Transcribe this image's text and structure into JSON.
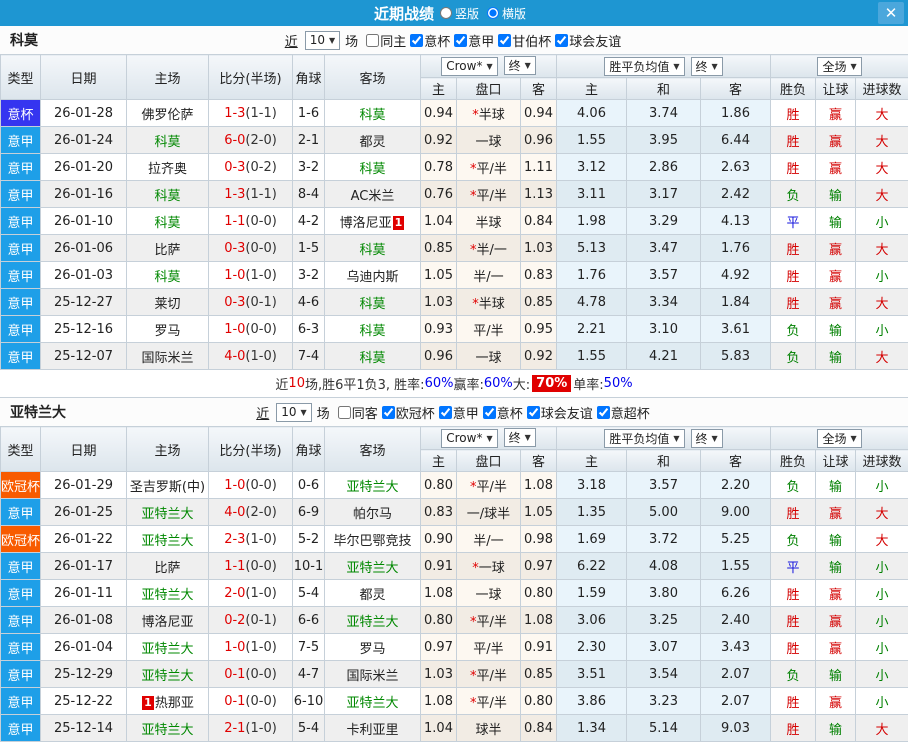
{
  "titlebar": {
    "title": "近期战绩",
    "vertical_label": "竖版",
    "horizontal_label": "横版",
    "close_glyph": "✕"
  },
  "table_header": {
    "main": [
      "类型",
      "日期",
      "主场",
      "比分(半场)",
      "角球",
      "客场"
    ],
    "bookmaker": "Crow*",
    "final": "终",
    "europe_avg": "胜平负均值",
    "scope": "全场",
    "sub": [
      "主",
      "盘口",
      "客",
      "主",
      "和",
      "客",
      "胜负",
      "让球",
      "进球数"
    ]
  },
  "result_color_map": {
    "胜": "r",
    "平": "b",
    "负": "g",
    "赢": "r",
    "输": "g",
    "大": "r",
    "小": "g"
  },
  "colors": {
    "titlebar": "#1E96D2",
    "serie_badge": "#1E9FE8",
    "cup_badge": "#3535F0",
    "ucl_badge": "#F85B00",
    "focus_team_green": "#008800",
    "score_red": "#E00000",
    "win_red": "#D40000",
    "draw_blue": "#1414DD",
    "lose_green": "#008000",
    "summary_pct_blue": "#0000EE"
  },
  "sections": [
    {
      "team": "科莫",
      "filter": {
        "near_label": "近",
        "count": "10",
        "games_label": "场",
        "same_label": "同主",
        "same_checked": false,
        "leagues": [
          "意杯",
          "意甲",
          "甘伯杯",
          "球会友谊"
        ]
      },
      "rows": [
        {
          "type": "意杯",
          "type_class": "cup",
          "date": "26-01-28",
          "home": "佛罗伦萨",
          "home_focus": false,
          "score": "1-3",
          "half": "(1-1)",
          "corner": "1-6",
          "away": "科莫",
          "away_focus": true,
          "ah": [
            "0.94",
            "*半球",
            "0.94"
          ],
          "eu": [
            "4.06",
            "3.74",
            "1.86"
          ],
          "res": [
            "胜",
            "赢",
            "大"
          ]
        },
        {
          "type": "意甲",
          "type_class": "serie",
          "date": "26-01-24",
          "home": "科莫",
          "home_focus": true,
          "score": "6-0",
          "half": "(2-0)",
          "corner": "2-1",
          "away": "都灵",
          "away_focus": false,
          "ah": [
            "0.92",
            "一球",
            "0.96"
          ],
          "eu": [
            "1.55",
            "3.95",
            "6.44"
          ],
          "res": [
            "胜",
            "赢",
            "大"
          ]
        },
        {
          "type": "意甲",
          "type_class": "serie",
          "date": "26-01-20",
          "home": "拉齐奥",
          "home_focus": false,
          "score": "0-3",
          "half": "(0-2)",
          "corner": "3-2",
          "away": "科莫",
          "away_focus": true,
          "ah": [
            "0.78",
            "*平/半",
            "1.11"
          ],
          "eu": [
            "3.12",
            "2.86",
            "2.63"
          ],
          "res": [
            "胜",
            "赢",
            "大"
          ]
        },
        {
          "type": "意甲",
          "type_class": "serie",
          "date": "26-01-16",
          "home": "科莫",
          "home_focus": true,
          "score": "1-3",
          "half": "(1-1)",
          "corner": "8-4",
          "away": "AC米兰",
          "away_focus": false,
          "ah": [
            "0.76",
            "*平/半",
            "1.13"
          ],
          "eu": [
            "3.11",
            "3.17",
            "2.42"
          ],
          "res": [
            "负",
            "输",
            "大"
          ]
        },
        {
          "type": "意甲",
          "type_class": "serie",
          "date": "26-01-10",
          "home": "科莫",
          "home_focus": true,
          "score": "1-1",
          "half": "(0-0)",
          "corner": "4-2",
          "away": "博洛尼亚",
          "away_focus": false,
          "away_card": "1",
          "away_card_pos": "post",
          "ah": [
            "1.04",
            "半球",
            "0.84"
          ],
          "eu": [
            "1.98",
            "3.29",
            "4.13"
          ],
          "res": [
            "平",
            "输",
            "小"
          ]
        },
        {
          "type": "意甲",
          "type_class": "serie",
          "date": "26-01-06",
          "home": "比萨",
          "home_focus": false,
          "score": "0-3",
          "half": "(0-0)",
          "corner": "1-5",
          "away": "科莫",
          "away_focus": true,
          "ah": [
            "0.85",
            "*半/一",
            "1.03"
          ],
          "eu": [
            "5.13",
            "3.47",
            "1.76"
          ],
          "res": [
            "胜",
            "赢",
            "大"
          ]
        },
        {
          "type": "意甲",
          "type_class": "serie",
          "date": "26-01-03",
          "home": "科莫",
          "home_focus": true,
          "score": "1-0",
          "half": "(1-0)",
          "corner": "3-2",
          "away": "乌迪内斯",
          "away_focus": false,
          "ah": [
            "1.05",
            "半/一",
            "0.83"
          ],
          "eu": [
            "1.76",
            "3.57",
            "4.92"
          ],
          "res": [
            "胜",
            "赢",
            "小"
          ]
        },
        {
          "type": "意甲",
          "type_class": "serie",
          "date": "25-12-27",
          "home": "莱切",
          "home_focus": false,
          "score": "0-3",
          "half": "(0-1)",
          "corner": "4-6",
          "away": "科莫",
          "away_focus": true,
          "ah": [
            "1.03",
            "*半球",
            "0.85"
          ],
          "eu": [
            "4.78",
            "3.34",
            "1.84"
          ],
          "res": [
            "胜",
            "赢",
            "大"
          ]
        },
        {
          "type": "意甲",
          "type_class": "serie",
          "date": "25-12-16",
          "home": "罗马",
          "home_focus": false,
          "score": "1-0",
          "half": "(0-0)",
          "corner": "6-3",
          "away": "科莫",
          "away_focus": true,
          "ah": [
            "0.93",
            "平/半",
            "0.95"
          ],
          "eu": [
            "2.21",
            "3.10",
            "3.61"
          ],
          "res": [
            "负",
            "输",
            "小"
          ]
        },
        {
          "type": "意甲",
          "type_class": "serie",
          "date": "25-12-07",
          "home": "国际米兰",
          "home_focus": false,
          "score": "4-0",
          "half": "(1-0)",
          "corner": "7-4",
          "away": "科莫",
          "away_focus": true,
          "ah": [
            "0.96",
            "一球",
            "0.92"
          ],
          "eu": [
            "1.55",
            "4.21",
            "5.83"
          ],
          "res": [
            "负",
            "输",
            "大"
          ]
        }
      ],
      "summary": [
        {
          "t": "近",
          "c": "k"
        },
        {
          "t": "10",
          "c": "r"
        },
        {
          "t": "场,胜6平1负3, 胜率:",
          "c": "k"
        },
        {
          "t": "60%",
          "c": "b"
        },
        {
          "t": " 赢率:",
          "c": "k"
        },
        {
          "t": "60%",
          "c": "b"
        },
        {
          "t": " 大:",
          "c": "k"
        },
        {
          "t": "70%",
          "c": "wr"
        },
        {
          "t": " 单率:",
          "c": "k"
        },
        {
          "t": "50%",
          "c": "b"
        }
      ]
    },
    {
      "team": "亚特兰大",
      "filter": {
        "near_label": "近",
        "count": "10",
        "games_label": "场",
        "same_label": "同客",
        "same_checked": false,
        "leagues": [
          "欧冠杯",
          "意甲",
          "意杯",
          "球会友谊",
          "意超杯"
        ]
      },
      "rows": [
        {
          "type": "欧冠杯",
          "type_class": "ucl",
          "date": "26-01-29",
          "home": "圣吉罗斯(中)",
          "home_focus": false,
          "score": "1-0",
          "half": "(0-0)",
          "corner": "0-6",
          "away": "亚特兰大",
          "away_focus": true,
          "ah": [
            "0.80",
            "*平/半",
            "1.08"
          ],
          "eu": [
            "3.18",
            "3.57",
            "2.20"
          ],
          "res": [
            "负",
            "输",
            "小"
          ]
        },
        {
          "type": "意甲",
          "type_class": "serie",
          "date": "26-01-25",
          "home": "亚特兰大",
          "home_focus": true,
          "score": "4-0",
          "half": "(2-0)",
          "corner": "6-9",
          "away": "帕尔马",
          "away_focus": false,
          "ah": [
            "0.83",
            "一/球半",
            "1.05"
          ],
          "eu": [
            "1.35",
            "5.00",
            "9.00"
          ],
          "res": [
            "胜",
            "赢",
            "大"
          ]
        },
        {
          "type": "欧冠杯",
          "type_class": "ucl",
          "date": "26-01-22",
          "home": "亚特兰大",
          "home_focus": true,
          "score": "2-3",
          "half": "(1-0)",
          "corner": "5-2",
          "away": "毕尔巴鄂竞技",
          "away_focus": false,
          "ah": [
            "0.90",
            "半/一",
            "0.98"
          ],
          "eu": [
            "1.69",
            "3.72",
            "5.25"
          ],
          "res": [
            "负",
            "输",
            "大"
          ]
        },
        {
          "type": "意甲",
          "type_class": "serie",
          "date": "26-01-17",
          "home": "比萨",
          "home_focus": false,
          "score": "1-1",
          "half": "(0-0)",
          "corner": "10-1",
          "away": "亚特兰大",
          "away_focus": true,
          "ah": [
            "0.91",
            "*一球",
            "0.97"
          ],
          "eu": [
            "6.22",
            "4.08",
            "1.55"
          ],
          "res": [
            "平",
            "输",
            "小"
          ]
        },
        {
          "type": "意甲",
          "type_class": "serie",
          "date": "26-01-11",
          "home": "亚特兰大",
          "home_focus": true,
          "score": "2-0",
          "half": "(1-0)",
          "corner": "5-4",
          "away": "都灵",
          "away_focus": false,
          "ah": [
            "1.08",
            "一球",
            "0.80"
          ],
          "eu": [
            "1.59",
            "3.80",
            "6.26"
          ],
          "res": [
            "胜",
            "赢",
            "小"
          ]
        },
        {
          "type": "意甲",
          "type_class": "serie",
          "date": "26-01-08",
          "home": "博洛尼亚",
          "home_focus": false,
          "score": "0-2",
          "half": "(0-1)",
          "corner": "6-6",
          "away": "亚特兰大",
          "away_focus": true,
          "ah": [
            "0.80",
            "*平/半",
            "1.08"
          ],
          "eu": [
            "3.06",
            "3.25",
            "2.40"
          ],
          "res": [
            "胜",
            "赢",
            "小"
          ]
        },
        {
          "type": "意甲",
          "type_class": "serie",
          "date": "26-01-04",
          "home": "亚特兰大",
          "home_focus": true,
          "score": "1-0",
          "half": "(1-0)",
          "corner": "7-5",
          "away": "罗马",
          "away_focus": false,
          "ah": [
            "0.97",
            "平/半",
            "0.91"
          ],
          "eu": [
            "2.30",
            "3.07",
            "3.43"
          ],
          "res": [
            "胜",
            "赢",
            "小"
          ]
        },
        {
          "type": "意甲",
          "type_class": "serie",
          "date": "25-12-29",
          "home": "亚特兰大",
          "home_focus": true,
          "score": "0-1",
          "half": "(0-0)",
          "corner": "4-7",
          "away": "国际米兰",
          "away_focus": false,
          "ah": [
            "1.03",
            "*平/半",
            "0.85"
          ],
          "eu": [
            "3.51",
            "3.54",
            "2.07"
          ],
          "res": [
            "负",
            "输",
            "小"
          ]
        },
        {
          "type": "意甲",
          "type_class": "serie",
          "date": "25-12-22",
          "home": "热那亚",
          "home_focus": false,
          "home_card": "1",
          "home_card_pos": "pre",
          "score": "0-1",
          "half": "(0-0)",
          "corner": "6-10",
          "away": "亚特兰大",
          "away_focus": true,
          "ah": [
            "1.08",
            "*平/半",
            "0.80"
          ],
          "eu": [
            "3.86",
            "3.23",
            "2.07"
          ],
          "res": [
            "胜",
            "赢",
            "小"
          ]
        },
        {
          "type": "意甲",
          "type_class": "serie",
          "date": "25-12-14",
          "home": "亚特兰大",
          "home_focus": true,
          "score": "2-1",
          "half": "(1-0)",
          "corner": "5-4",
          "away": "卡利亚里",
          "away_focus": false,
          "ah": [
            "1.04",
            "球半",
            "0.84"
          ],
          "eu": [
            "1.34",
            "5.14",
            "9.03"
          ],
          "res": [
            "胜",
            "输",
            "大"
          ]
        }
      ]
    }
  ]
}
